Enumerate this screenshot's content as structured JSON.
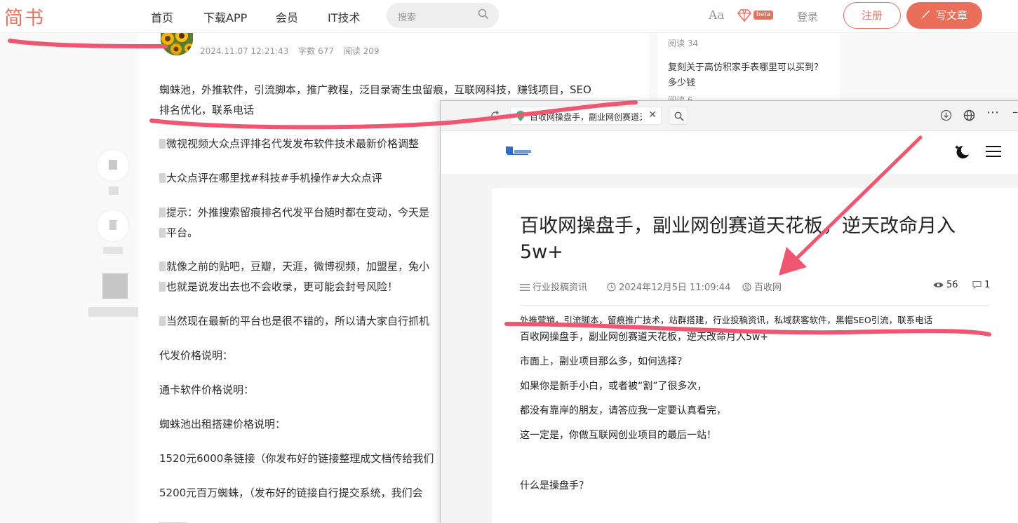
{
  "jianshu": {
    "logo": "简书",
    "nav": [
      "首页",
      "下载APP",
      "会员",
      "IT技术"
    ],
    "search_placeholder": "搜索",
    "font_toggle": "Aa",
    "beta_label": "beta",
    "login": "登录",
    "register": "注册",
    "write": "写文章",
    "accent": "#ea6f5a"
  },
  "article": {
    "date": "2024.11.07 12:21:43",
    "words": "字数 677",
    "reads": "阅读 209",
    "keywords_line1": "蜘蛛池，外推软件，引流脚本，推广教程，泛目录寄生虫留痕，互联网科技，赚钱项目，SEO",
    "keywords_line2": "排名优化，联系电话",
    "lines": [
      "微视视频大众点评排名代发发布软件技术最新价格调整",
      "大众点评在哪里找#科技#手机操作#大众点评",
      "提示：外推搜索留痕排名代发平台随时都在变动，今天是",
      "平台。",
      "就像之前的贴吧，豆瓣，天涯，微博视频，加盟星，兔小",
      "也就是说发出去也不会收录，更可能会封号风险！",
      "当然现在最新的平台也是很不错的，所以请大家自行抓机",
      "代发价格说明：",
      "通卡软件价格说明：",
      "蜘蛛池出租搭建价格说明：",
      "1520元6000条链接（你发布好的链接整理成文档传给我们",
      "5200元百万蜘蛛，（发布好的链接自行提交系统，我们会"
    ]
  },
  "sidebar": {
    "read1": "阅读 34",
    "title": "复刻关于高仿积家手表哪里可以买到？多少钱",
    "read2": "阅读 6"
  },
  "browser": {
    "tab_title": "百收网操盘手，副业网创赛道天花板",
    "post": {
      "title": "百收网操盘手，副业网创赛道天花板，逆天改命月入5w+",
      "category": "行业投稿资讯",
      "datetime": "2024年12月5日 11:09:44",
      "author": "百收网",
      "views": "56",
      "comments": "1",
      "tags": "外推营销，引流脚本，留痕推广技术，站群搭建，行业投稿资讯，私域获客软件，黑帽SEO引流，联系电话",
      "body": [
        "百收网操盘手，副业网创赛道天花板，逆天改命月入5w+",
        "市面上，副业项目那么多，如何选择？",
        "如果你是新手小白，或者被“割”了很多次，",
        "都没有靠岸的朋友，请答应我一定要认真看完，",
        "这一定是，你做互联网创业项目的最后一站！",
        "什么是操盘手？"
      ]
    }
  },
  "annotation_color": "#f0566f"
}
